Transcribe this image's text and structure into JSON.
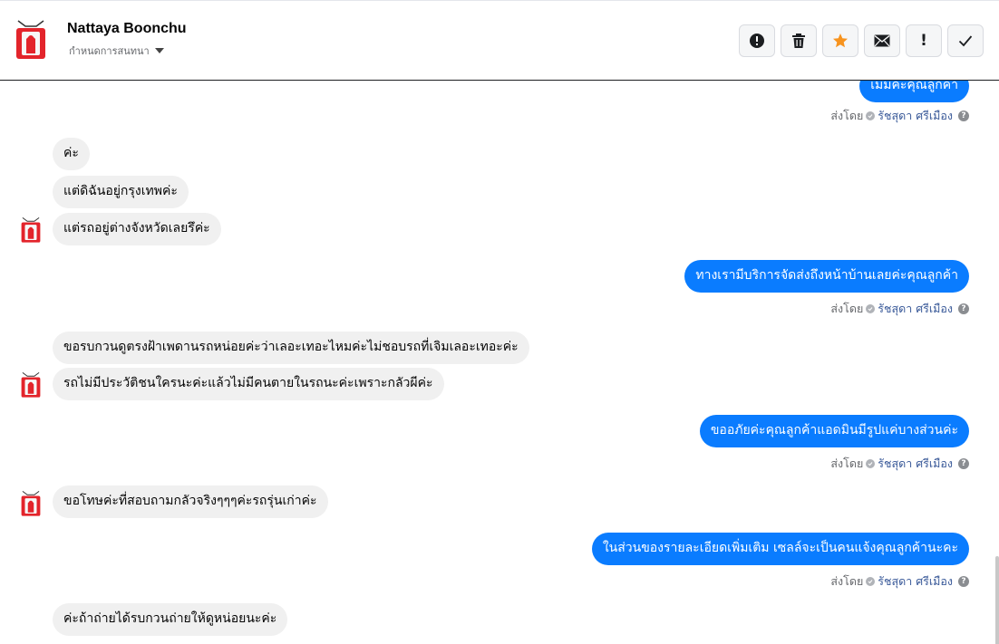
{
  "header": {
    "contact_name": "Nattaya Boonchu",
    "subtitle": "กำหนดการสนทนา"
  },
  "toolbar": {
    "buttons": [
      {
        "icon": "alert-circle-icon"
      },
      {
        "icon": "trash-icon"
      },
      {
        "icon": "star-icon",
        "color": "#f7931e"
      },
      {
        "icon": "mail-icon"
      },
      {
        "icon": "exclamation-icon",
        "label": "!"
      },
      {
        "icon": "checkmark-icon"
      }
    ]
  },
  "meta": {
    "sent_by": "ส่งโดย",
    "agent": "รัชสุดา ศรีเมือง"
  },
  "messages": {
    "m0": "เมมคะคุณลูกคา",
    "m1": "ค่ะ",
    "m2": "แต่ดิฉันอยู่กรุงเทพค่ะ",
    "m3": "แต่รถอยู่ต่างจังหวัดเลยรึค่ะ",
    "m4": "ทางเรามีบริการจัดส่งถึงหน้าบ้านเลยค่ะคุณลูกค้า",
    "m5": "ขอรบกวนดูตรงฝ้าเพดานรถหน่อยค่ะว่าเลอะเทอะไหมค่ะไม่ชอบรถที่เจิมเลอะเทอะค่ะ",
    "m6": "รถไม่มีประวัติชนใครนะค่ะแล้วไม่มีคนตายในรถนะค่ะเพราะกลัวผีค่ะ",
    "m7": "ขออภัยค่ะคุณลูกค้าแอดมินมีรูปแค่บางส่วนค่ะ",
    "m8": "ขอโทษค่ะที่สอบถามกลัวจริงๆๆๆค่ะรถรุ่นเก่าค่ะ",
    "m9": "ในส่วนของรายละเอียดเพิ่มเติม  เซลล์จะเป็นคนแจ้งคุณลูกค้านะคะ",
    "m10": "ค่ะถ้าถ่ายได้รบกวนถ่ายให้ดูหน่อยนะค่ะ"
  },
  "colors": {
    "outgoing_bubble": "#0a7cff",
    "incoming_bubble": "#f0f0f0"
  }
}
